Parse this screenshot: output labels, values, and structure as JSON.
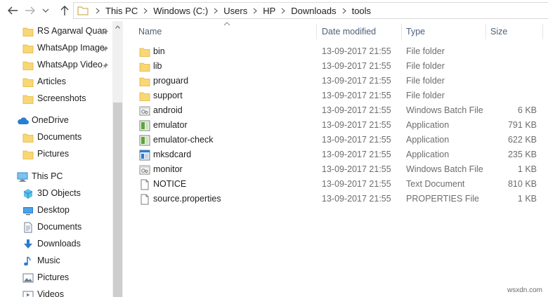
{
  "breadcrumb": [
    "This PC",
    "Windows (C:)",
    "Users",
    "HP",
    "Downloads",
    "tools"
  ],
  "nav": {
    "quick_access": [
      {
        "label": "RS Agarwal Quan",
        "pinned": true,
        "icon": "folder-icon"
      },
      {
        "label": "WhatsApp Image",
        "pinned": true,
        "icon": "folder-icon"
      },
      {
        "label": "WhatsApp Video",
        "pinned": true,
        "icon": "folder-icon"
      },
      {
        "label": "Articles",
        "pinned": false,
        "icon": "folder-icon"
      },
      {
        "label": "Screenshots",
        "pinned": false,
        "icon": "folder-icon"
      }
    ],
    "onedrive": {
      "label": "OneDrive",
      "icon": "cloud-icon"
    },
    "onedrive_items": [
      {
        "label": "Documents",
        "icon": "folder-icon"
      },
      {
        "label": "Pictures",
        "icon": "folder-icon"
      }
    ],
    "thispc": {
      "label": "This PC",
      "icon": "computer-icon"
    },
    "thispc_items": [
      {
        "label": "3D Objects",
        "icon": "cube-icon"
      },
      {
        "label": "Desktop",
        "icon": "desktop-icon"
      },
      {
        "label": "Documents",
        "icon": "documents-icon"
      },
      {
        "label": "Downloads",
        "icon": "download-arrow-icon"
      },
      {
        "label": "Music",
        "icon": "music-note-icon"
      },
      {
        "label": "Pictures",
        "icon": "pictures-icon"
      },
      {
        "label": "Videos",
        "icon": "videos-icon"
      }
    ]
  },
  "columns": {
    "name": "Name",
    "date": "Date modified",
    "type": "Type",
    "size": "Size"
  },
  "files": [
    {
      "name": "bin",
      "date": "13-09-2017 21:55",
      "type": "File folder",
      "size": "",
      "icon": "folder"
    },
    {
      "name": "lib",
      "date": "13-09-2017 21:55",
      "type": "File folder",
      "size": "",
      "icon": "folder"
    },
    {
      "name": "proguard",
      "date": "13-09-2017 21:55",
      "type": "File folder",
      "size": "",
      "icon": "folder"
    },
    {
      "name": "support",
      "date": "13-09-2017 21:55",
      "type": "File folder",
      "size": "",
      "icon": "folder"
    },
    {
      "name": "android",
      "date": "13-09-2017 21:55",
      "type": "Windows Batch File",
      "size": "6 KB",
      "icon": "batch"
    },
    {
      "name": "emulator",
      "date": "13-09-2017 21:55",
      "type": "Application",
      "size": "791 KB",
      "icon": "app-green"
    },
    {
      "name": "emulator-check",
      "date": "13-09-2017 21:55",
      "type": "Application",
      "size": "622 KB",
      "icon": "app-green"
    },
    {
      "name": "mksdcard",
      "date": "13-09-2017 21:55",
      "type": "Application",
      "size": "235 KB",
      "icon": "app-blue"
    },
    {
      "name": "monitor",
      "date": "13-09-2017 21:55",
      "type": "Windows Batch File",
      "size": "1 KB",
      "icon": "batch"
    },
    {
      "name": "NOTICE",
      "date": "13-09-2017 21:55",
      "type": "Text Document",
      "size": "810 KB",
      "icon": "text"
    },
    {
      "name": "source.properties",
      "date": "13-09-2017 21:55",
      "type": "PROPERTIES File",
      "size": "1 KB",
      "icon": "text"
    }
  ],
  "watermark": "wsxdn.com",
  "colors": {
    "folder": "#f8d775",
    "folder_dark": "#e8b83a",
    "accent": "#2b7cd3",
    "header_text": "#4c607a"
  }
}
